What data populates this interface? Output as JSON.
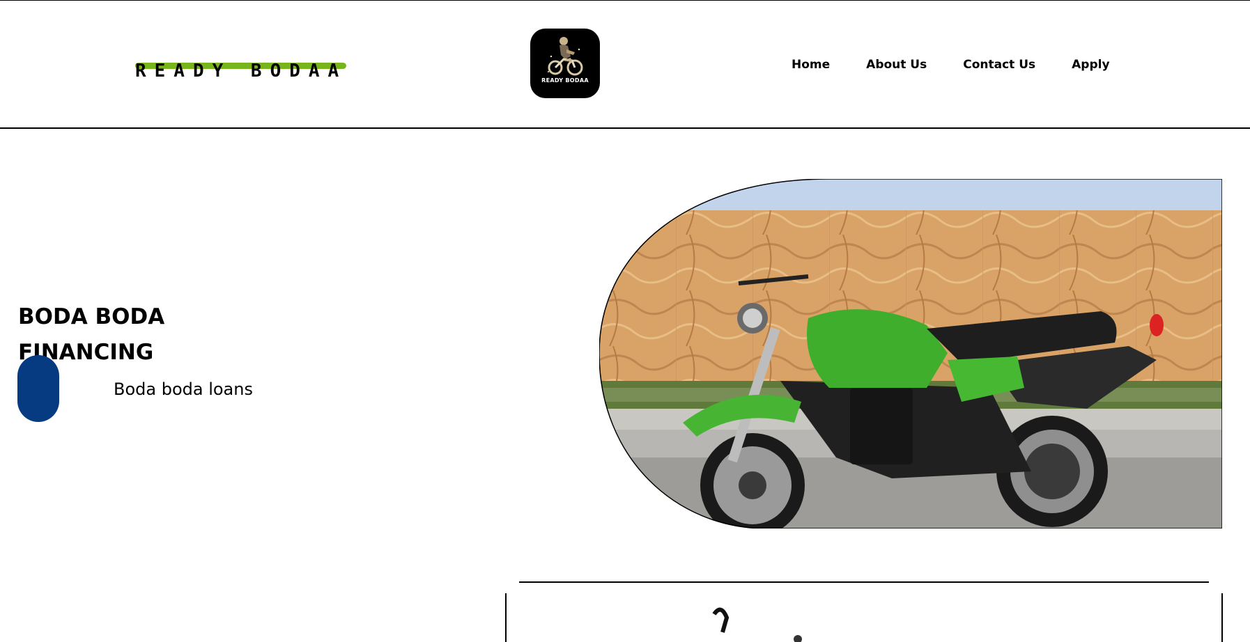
{
  "brand": {
    "name": "READY BODAA",
    "accent_color": "#78b51d"
  },
  "logo": {
    "caption": "READY BODAA",
    "icon": "motorcycle-rider-icon"
  },
  "nav": {
    "items": [
      {
        "label": "Home"
      },
      {
        "label": "About Us"
      },
      {
        "label": "Contact Us"
      },
      {
        "label": "Apply"
      }
    ]
  },
  "hero": {
    "title": "BODA BODA FINANCING",
    "subtitle": "Boda boda loans",
    "pill_color": "#063b82",
    "image": "green-electric-motorcycle-photo"
  }
}
